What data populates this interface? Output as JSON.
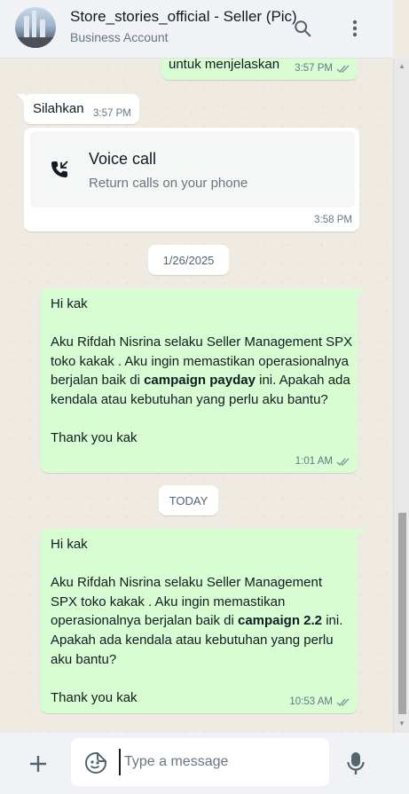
{
  "header": {
    "contact_name": "Store_stories_official - Seller (Pic)",
    "contact_subtitle": "Business Account",
    "search_icon": "search-icon",
    "menu_icon": "kebab-menu-icon"
  },
  "messages": [
    {
      "direction": "out",
      "text": "untuk menjelaskan",
      "time": "3:57 PM",
      "status": "read"
    },
    {
      "direction": "in",
      "text": "Silahkan",
      "time": "3:57 PM"
    },
    {
      "direction": "in",
      "type": "call",
      "call_title": "Voice call",
      "call_subtitle": "Return calls on your phone",
      "time": "3:58 PM"
    },
    {
      "type": "date",
      "label": "1/26/2025"
    },
    {
      "direction": "out",
      "greeting": "Hi kak",
      "body_intro": "Aku Rifdah Nisrina selaku Seller Management SPX toko kakak . Aku ingin memastikan operasionalnya berjalan baik di ",
      "body_bold": "campaign payday",
      "body_rest": " ini. Apakah ada kendala atau kebutuhan yang perlu aku bantu?",
      "closing": "Thank you kak",
      "time": "1:01 AM",
      "status": "read"
    },
    {
      "type": "date",
      "label": "TODAY"
    },
    {
      "direction": "out",
      "greeting": "Hi kak",
      "body_intro": "Aku Rifdah Nisrina selaku Seller Management SPX toko kakak . Aku ingin memastikan operasionalnya berjalan baik di ",
      "body_bold": "campaign 2.2",
      "body_rest": " ini. Apakah ada kendala atau kebutuhan yang perlu aku bantu?",
      "closing": "Thank you kak",
      "time": "10:53 AM",
      "status": "read"
    }
  ],
  "composer": {
    "placeholder": "Type a message",
    "attach_icon": "plus-icon",
    "emoji_icon": "sticker-emoji-icon",
    "mic_icon": "microphone-icon"
  },
  "colors": {
    "outgoing_bubble": "#d9fdd3",
    "incoming_bubble": "#ffffff",
    "chat_background": "#efeae2",
    "read_ticks": "#8696a0"
  }
}
